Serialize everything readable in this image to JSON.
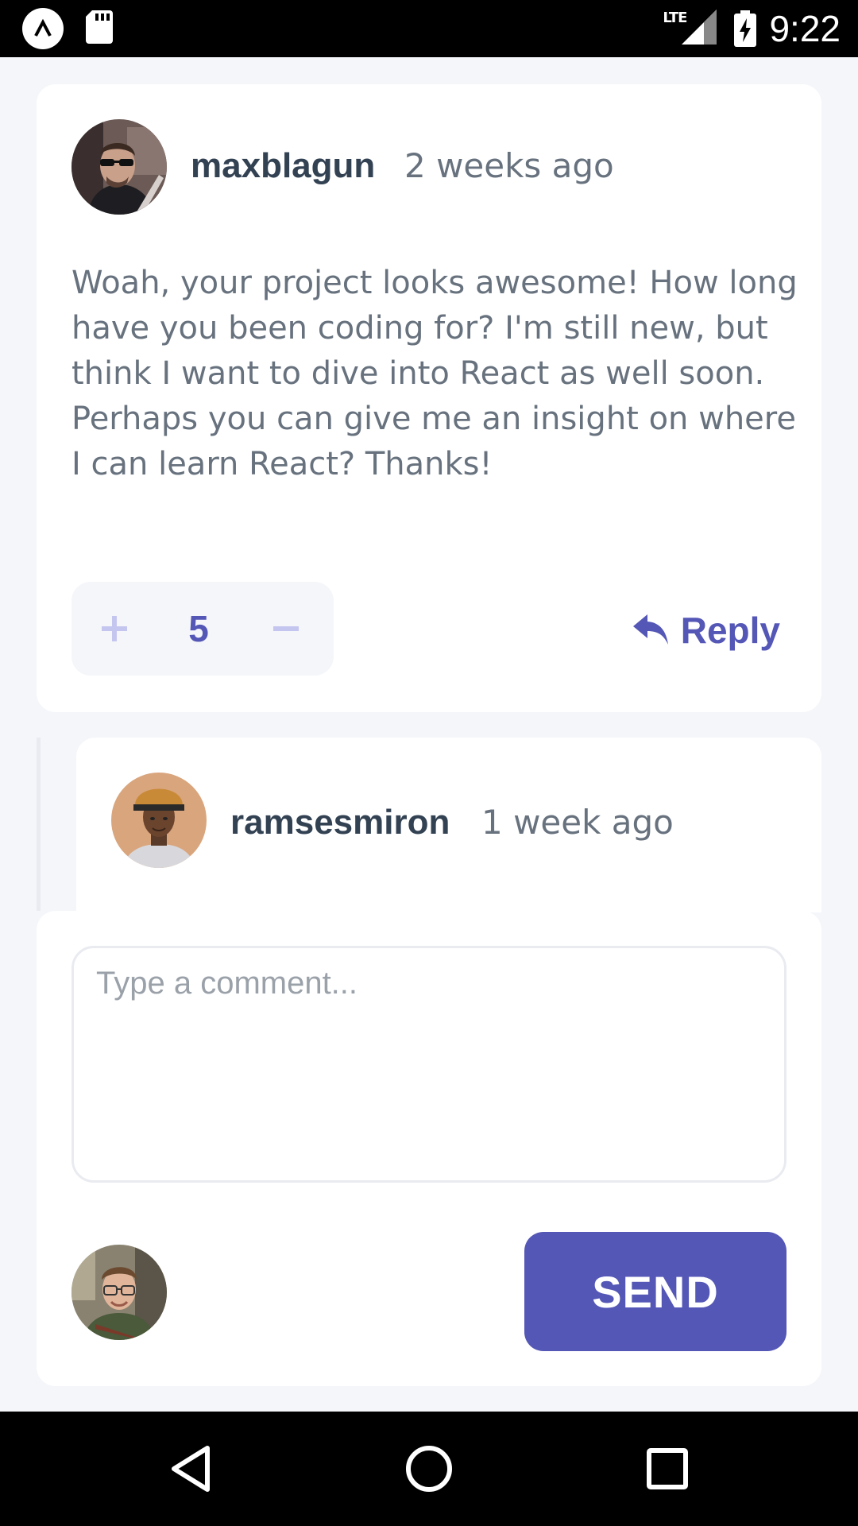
{
  "status_bar": {
    "network": "LTE",
    "time": "9:22"
  },
  "comment": {
    "username": "maxblagun",
    "time_ago": "2 weeks ago",
    "body": "Woah, your project looks awesome! How long have you been coding for? I'm still new, but think I want to dive into React as well soon. Perhaps you can give me an insight on where I can learn React? Thanks!",
    "score": "5",
    "reply_label": "Reply",
    "icons": {
      "upvote": "plus-icon",
      "downvote": "minus-icon",
      "reply": "reply-arrow-icon"
    }
  },
  "reply": {
    "username": "ramsesmiron",
    "time_ago": "1 week ago"
  },
  "composer": {
    "placeholder": "Type a comment...",
    "value": "",
    "send_label": "SEND"
  },
  "colors": {
    "accent": "#5457b6",
    "accent_light": "#c5c6ef",
    "text_dark": "#334253",
    "text_muted": "#67727e",
    "background": "#f5f6fa",
    "border": "#e9ebf0"
  }
}
